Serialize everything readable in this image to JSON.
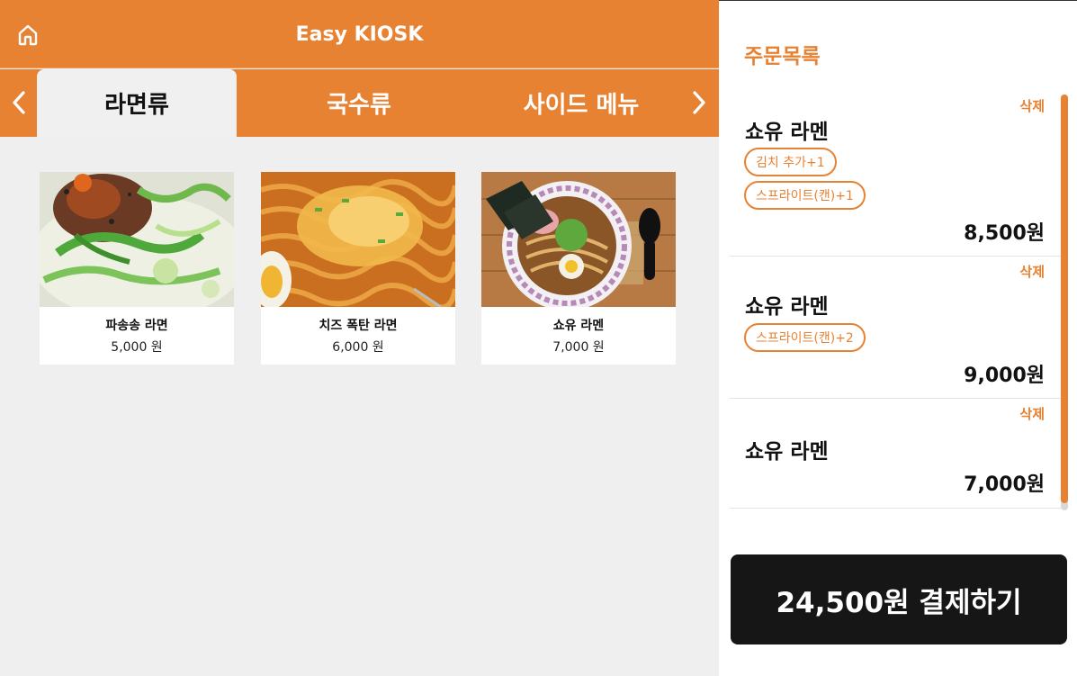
{
  "header": {
    "title": "Easy KIOSK",
    "home_icon": "home-icon"
  },
  "tabs": [
    {
      "label": "라면류",
      "active": true
    },
    {
      "label": "국수류",
      "active": false
    },
    {
      "label": "사이드 메뉴",
      "active": false
    }
  ],
  "menu": [
    {
      "name": "파송송 라면",
      "price": "5,000 원",
      "image": "spicy-ramen-with-green-onion"
    },
    {
      "name": "치즈 폭탄 라면",
      "price": "6,000 원",
      "image": "cheese-ramen"
    },
    {
      "name": "쇼유 라멘",
      "price": "7,000 원",
      "image": "shoyu-ramen-bowl"
    }
  ],
  "order": {
    "title": "주문목록",
    "items": [
      {
        "name": "쇼유 라멘",
        "delete_label": "삭제",
        "options": [
          "김치 추가+1",
          "스프라이트(캔)+1"
        ],
        "price": "8,500원"
      },
      {
        "name": "쇼유 라멘",
        "delete_label": "삭제",
        "options": [
          "스프라이트(캔)+2"
        ],
        "price": "9,000원"
      },
      {
        "name": "쇼유 라멘",
        "delete_label": "삭제",
        "options": [],
        "price": "7,000원"
      }
    ],
    "pay_label": "24,500원 결제하기"
  },
  "colors": {
    "accent": "#e88233",
    "pay_button": "#161616",
    "background": "#f0f0f0"
  }
}
